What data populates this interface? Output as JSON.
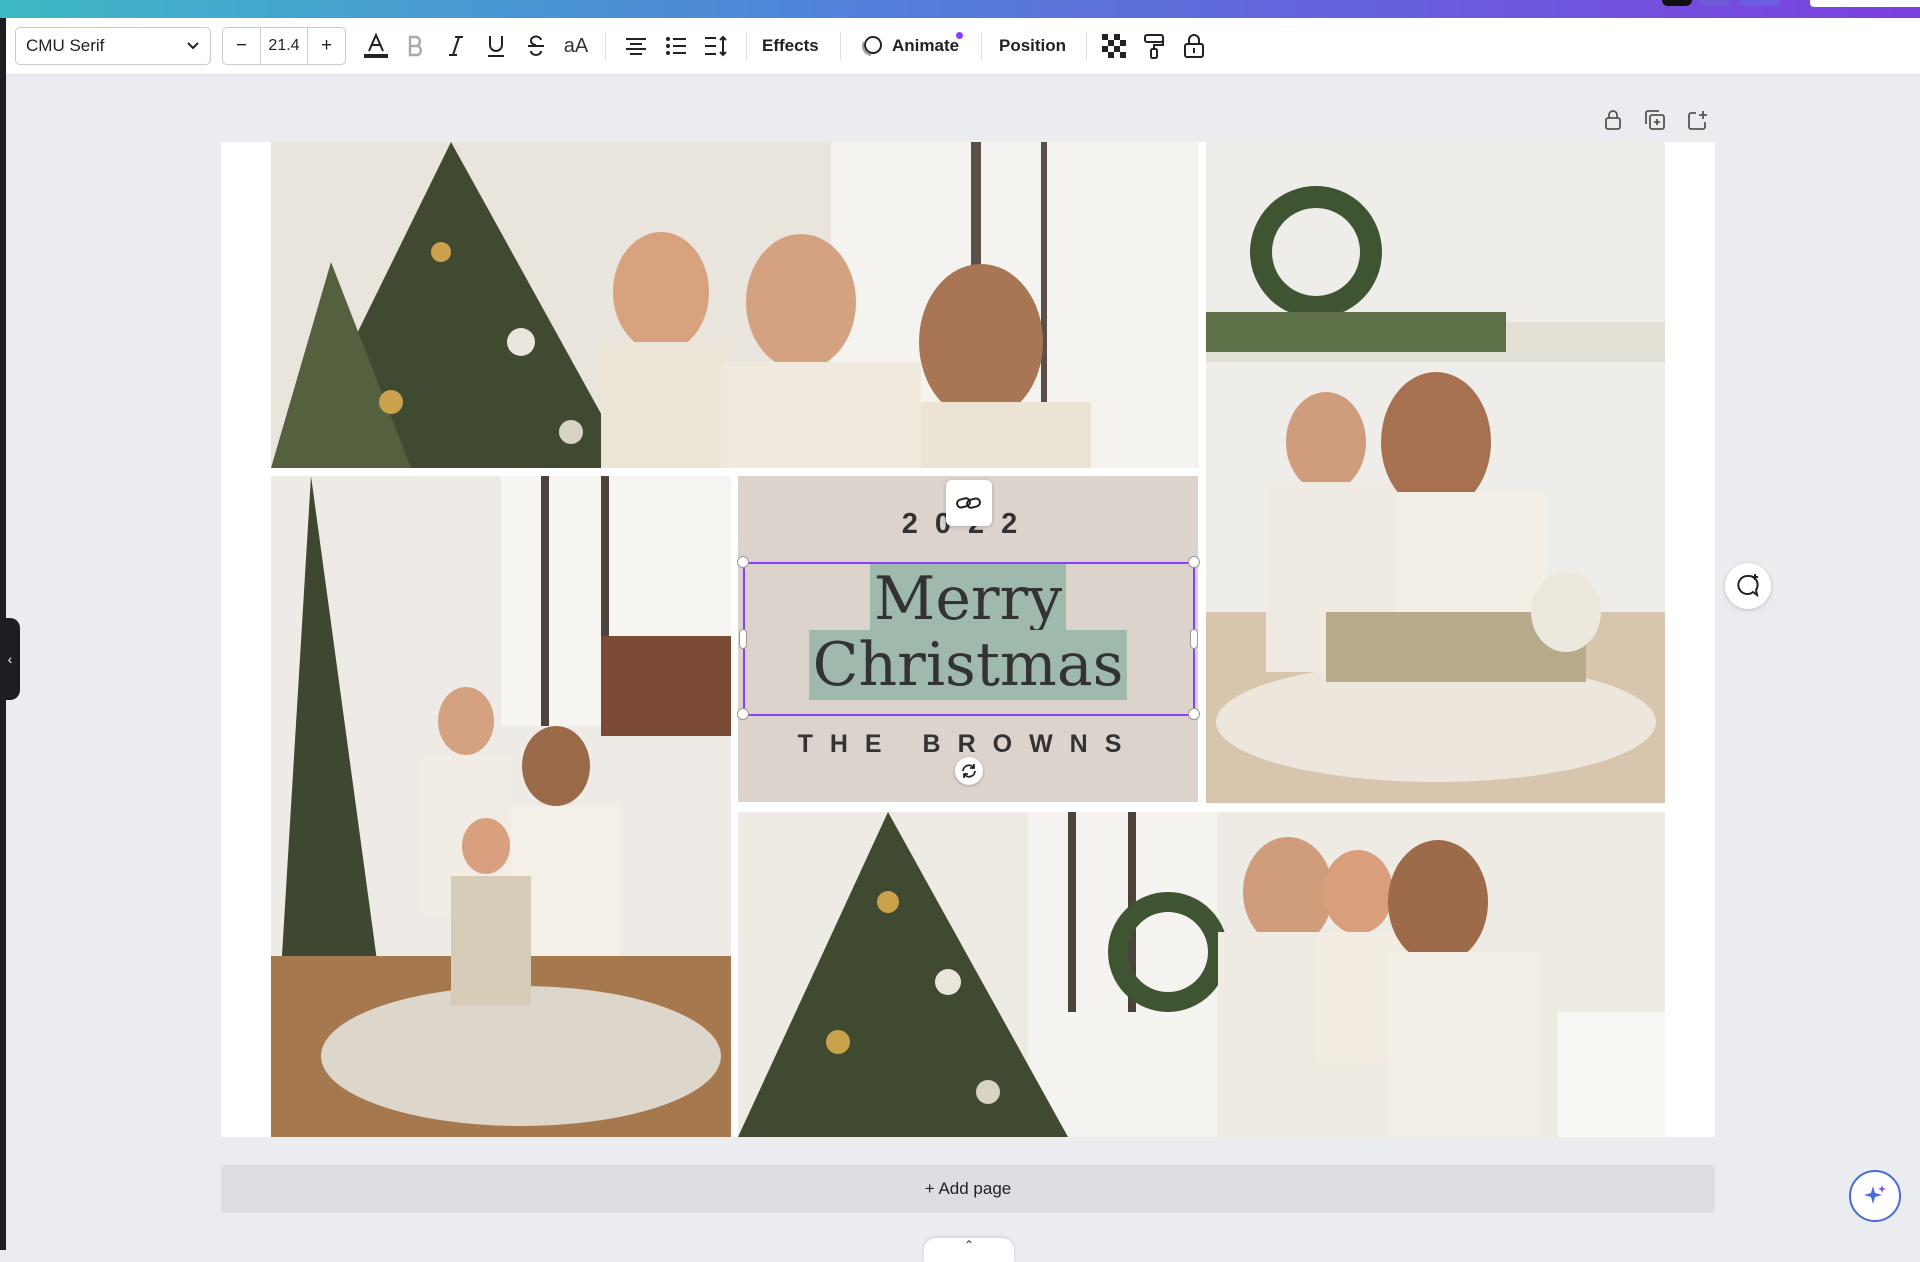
{
  "toolbar": {
    "font_family": "CMU Serif",
    "font_size": "21.4",
    "decrease_label": "−",
    "increase_label": "+",
    "case_label": "aA",
    "effects_label": "Effects",
    "animate_label": "Animate",
    "position_label": "Position"
  },
  "design": {
    "year": "2022",
    "greeting_line1": "Merry",
    "greeting_line2": "Christmas",
    "family": "THE BROWNS"
  },
  "footer": {
    "add_page_label": "+ Add page"
  },
  "colors": {
    "accent": "#8b3dff",
    "text_highlight": "#9fb9ad",
    "panel_bg": "#dcd3cd",
    "canvas_bg": "#ebecf0"
  },
  "icons": [
    "chevron-down-icon",
    "text-color-icon",
    "bold-icon",
    "italic-icon",
    "underline-icon",
    "strikethrough-icon",
    "align-center-icon",
    "list-icon",
    "line-spacing-icon",
    "animate-icon",
    "transparency-icon",
    "paint-format-icon",
    "lock-icon",
    "copy-icon",
    "share-icon",
    "link-icon",
    "rotate-icon",
    "comment-icon",
    "magic-icon"
  ]
}
